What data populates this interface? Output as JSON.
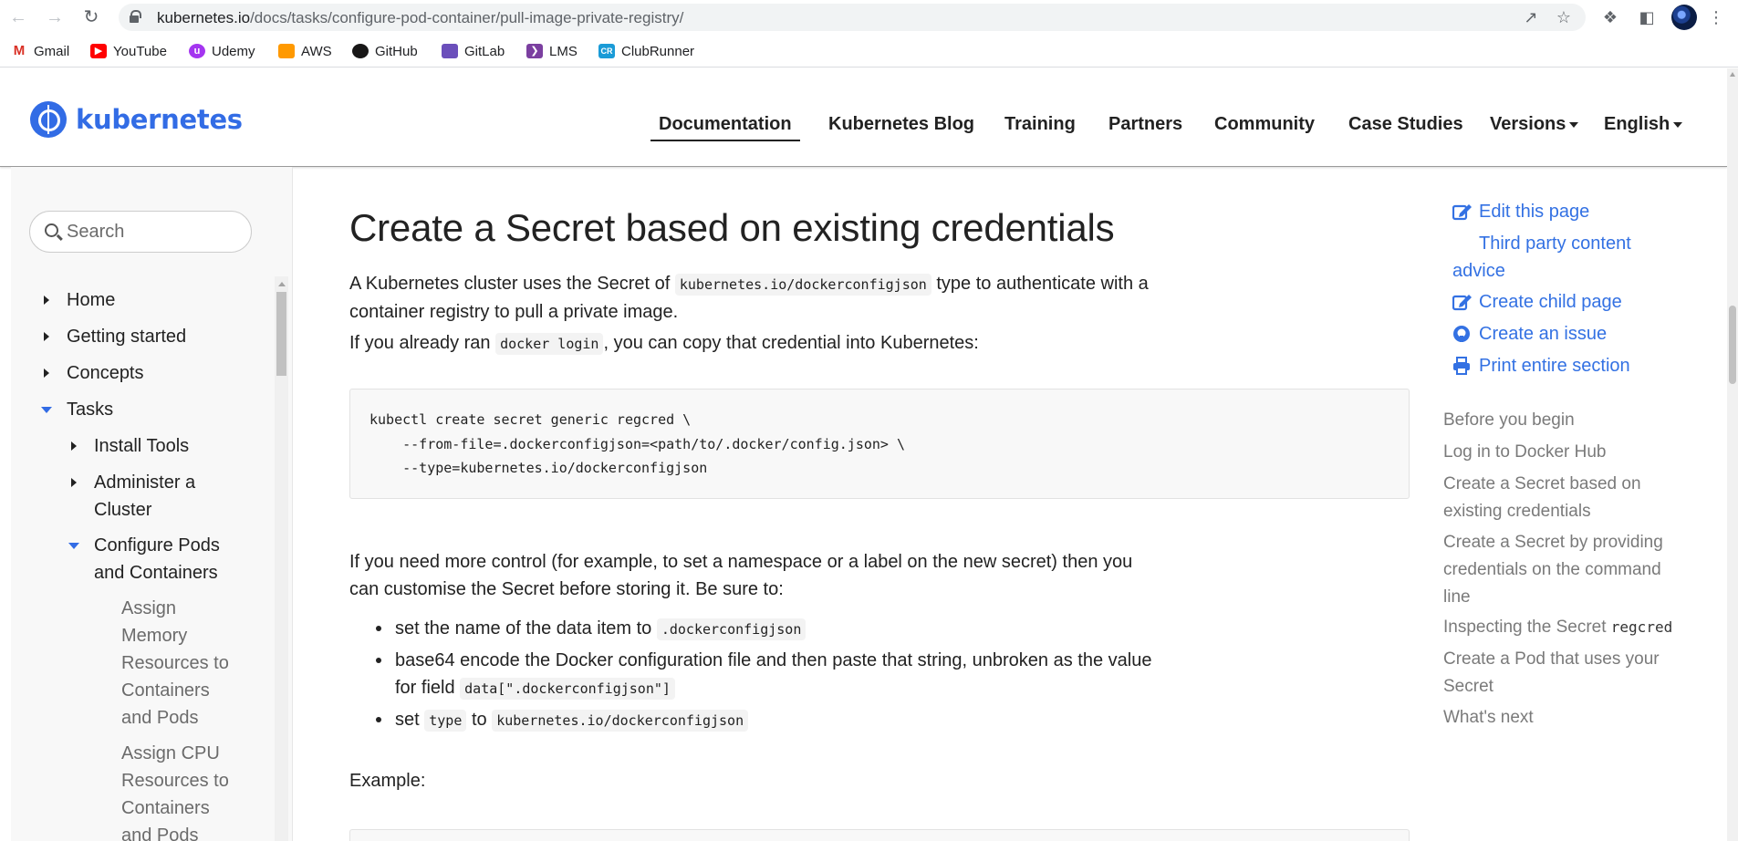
{
  "browser": {
    "url_host": "kubernetes.io",
    "url_path": "/docs/tasks/configure-pod-container/pull-image-private-registry/",
    "bookmarks": [
      {
        "label": "Gmail",
        "icon": "gmail-icon",
        "color": "#d93025"
      },
      {
        "label": "YouTube",
        "icon": "youtube-icon",
        "color": "#ff0000"
      },
      {
        "label": "Udemy",
        "icon": "udemy-icon",
        "color": "#a435f0"
      },
      {
        "label": "AWS",
        "icon": "aws-icon",
        "color": "#ff9900"
      },
      {
        "label": "GitHub",
        "icon": "github-icon",
        "color": "#181717"
      },
      {
        "label": "GitLab",
        "icon": "gitlab-icon",
        "color": "#6b4fbb"
      },
      {
        "label": "LMS",
        "icon": "lms-icon",
        "color": "#7b3fa0"
      },
      {
        "label": "ClubRunner",
        "icon": "clubrunner-icon",
        "color": "#1a9bd7"
      }
    ]
  },
  "site": {
    "logo_text": "kubernetes",
    "brand_color": "#326ce5",
    "nav": [
      {
        "label": "Documentation",
        "active": true
      },
      {
        "label": "Kubernetes Blog"
      },
      {
        "label": "Training"
      },
      {
        "label": "Partners"
      },
      {
        "label": "Community"
      },
      {
        "label": "Case Studies"
      },
      {
        "label": "Versions",
        "dropdown": true
      },
      {
        "label": "English",
        "dropdown": true
      }
    ]
  },
  "sidebar": {
    "search_placeholder": "Search",
    "items": [
      {
        "label": "Home",
        "state": "collapsed"
      },
      {
        "label": "Getting started",
        "state": "collapsed"
      },
      {
        "label": "Concepts",
        "state": "collapsed"
      },
      {
        "label": "Tasks",
        "state": "expanded"
      },
      {
        "label": "Install Tools",
        "state": "collapsed"
      },
      {
        "label_lines": [
          "Administer a",
          "Cluster"
        ],
        "state": "collapsed"
      },
      {
        "label_lines": [
          "Configure Pods",
          "and Containers"
        ],
        "state": "expanded"
      },
      {
        "label_lines": [
          "Assign",
          "Memory",
          "Resources to",
          "Containers",
          "and Pods"
        ]
      },
      {
        "label_lines": [
          "Assign CPU",
          "Resources to",
          "Containers",
          "and Pods"
        ]
      }
    ]
  },
  "content": {
    "heading": "Create a Secret based on existing credentials",
    "p1_a": "A Kubernetes cluster uses the Secret of",
    "p1_code": "kubernetes.io/dockerconfigjson",
    "p1_b": "type to authenticate with a",
    "p1_c": "container registry to pull a private image.",
    "p2_a": "If you already ran",
    "p2_code": "docker login",
    "p2_b": ", you can copy that credential into Kubernetes:",
    "code_lines": [
      "kubectl create secret generic regcred \\",
      "    --from-file=.dockerconfigjson=<path/to/.docker/config.json> \\",
      "    --type=kubernetes.io/dockerconfigjson"
    ],
    "p3_line1": "If you need more control (for example, to set a namespace or a label on the new secret) then you",
    "p3_line2": "can customise the Secret before storing it. Be sure to:",
    "bullets": {
      "b1_text": "set the name of the data item to",
      "b1_code": ".dockerconfigjson",
      "b2_line1": "base64 encode the Docker configuration file and then paste that string, unbroken as the value",
      "b2_line2_text": "for field",
      "b2_code": "data[\".dockerconfigjson\"]",
      "b3_text_a": "set",
      "b3_code_a": "type",
      "b3_text_b": "to",
      "b3_code_b": "kubernetes.io/dockerconfigjson"
    },
    "example_label": "Example:"
  },
  "toc": {
    "actions": [
      {
        "label": "Edit this page",
        "icon": "edit-icon"
      },
      {
        "label_lines": [
          "Third party content",
          "advice"
        ],
        "icon": ""
      },
      {
        "label": "Create child page",
        "icon": "edit-icon"
      },
      {
        "label": "Create an issue",
        "icon": "github-icon"
      },
      {
        "label": "Print entire section",
        "icon": "print-icon"
      }
    ],
    "link_color": "#3371e3",
    "entries": [
      {
        "lines": [
          "Before you begin"
        ]
      },
      {
        "lines": [
          "Log in to Docker Hub"
        ]
      },
      {
        "lines": [
          "Create a Secret based on",
          "existing credentials"
        ]
      },
      {
        "lines": [
          "Create a Secret by providing",
          "credentials on the command",
          "line"
        ]
      },
      {
        "text": "Inspecting the Secret",
        "code": "regcred"
      },
      {
        "lines": [
          "Create a Pod that uses your",
          "Secret"
        ]
      },
      {
        "lines": [
          "What's next"
        ]
      }
    ]
  }
}
